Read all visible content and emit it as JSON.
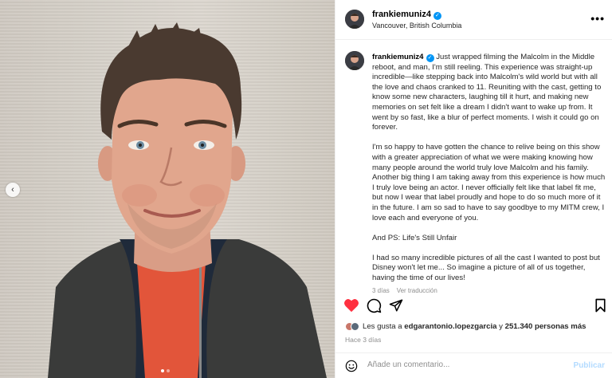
{
  "post": {
    "username": "frankiemuniz4",
    "location": "Vancouver, British Columbia",
    "more_icon": "more-horizontal-icon"
  },
  "caption": {
    "username": "frankiemuniz4",
    "paragraph1": "Just wrapped filming the Malcolm in the Middle reboot, and man, I'm still reeling. This experience was straight-up incredible—like stepping back into Malcolm's wild world but with all the love and chaos cranked to 11. Reuniting with the cast, getting to know some new characters, laughing till it hurt, and making new memories on set felt like a dream I didn't want to wake up from. It went by so fast, like a blur of perfect moments. I wish it could go on forever.",
    "paragraph2": "I'm so happy to have gotten the chance to relive being on this show with a greater appreciation of what we were making knowing how many people around the world truly love Malcolm and his family. Another big thing I am taking away from this experience is how much I truly love being an actor. I never officially felt like that label fit me, but now I wear that label proudly and hope to do so much more of it in the future. I am so sad to have to say goodbye to my MITM crew, I love each and everyone of you.",
    "paragraph3": "And PS: Life's Still Unfair",
    "paragraph4": "I had so many incredible pictures of all the cast I wanted to post but Disney won't let me... So imagine a picture of all of us together, having the time of our lives!",
    "time": "3 días",
    "translate": "Ver traducción"
  },
  "actions": {
    "like_icon": "heart-icon",
    "comment_icon": "comment-icon",
    "share_icon": "share-icon",
    "save_icon": "bookmark-icon"
  },
  "likes": {
    "prefix": "Les gusta a",
    "user": "edgarantonio.lopezgarcia",
    "connector": "y",
    "count": "251.340 personas más"
  },
  "posted_ago": "Hace 3 días",
  "comment": {
    "placeholder": "Añade un comentario...",
    "publish": "Publicar",
    "emoji_icon": "emoji-icon"
  },
  "carousel": {
    "prev_icon": "chevron-left-icon",
    "slide_count": 2,
    "active_slide": 1
  },
  "colors": {
    "like_red": "#ff3040",
    "verified_blue": "#0095f6",
    "publish_disabled": "#b3dbff"
  }
}
